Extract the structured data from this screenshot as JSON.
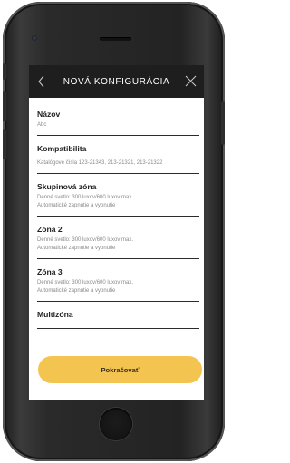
{
  "header": {
    "title": "NOVÁ KONFIGURÁCIA",
    "back_icon": "chevron-left-icon",
    "close_icon": "close-icon"
  },
  "items": [
    {
      "title": "Názov",
      "sub": [
        "Abc"
      ]
    },
    {
      "title": "Kompatibilita",
      "sub": [
        "Katalógové čísla 123-21343, 213-21321, 213-21322"
      ]
    },
    {
      "title": "Skupinová zóna",
      "sub": [
        "Denné svetlo: 300 luxov/600 luxov max.",
        "Automatické zapnutie a vypnutie"
      ]
    },
    {
      "title": "Zóna 2",
      "sub": [
        "Denné svetlo: 300 luxov/600 luxov max.",
        "Automatické zapnutie a vypnutie"
      ]
    },
    {
      "title": "Zóna 3",
      "sub": [
        "Denné svetlo: 300 luxov/600 luxov max.",
        "Automatické zapnutie a vypnutie"
      ]
    },
    {
      "title": "Multizóna",
      "sub": []
    }
  ],
  "continue_label": "Pokračovať",
  "colors": {
    "header_bg": "#1e1e1e",
    "accent": "#f3c450"
  }
}
